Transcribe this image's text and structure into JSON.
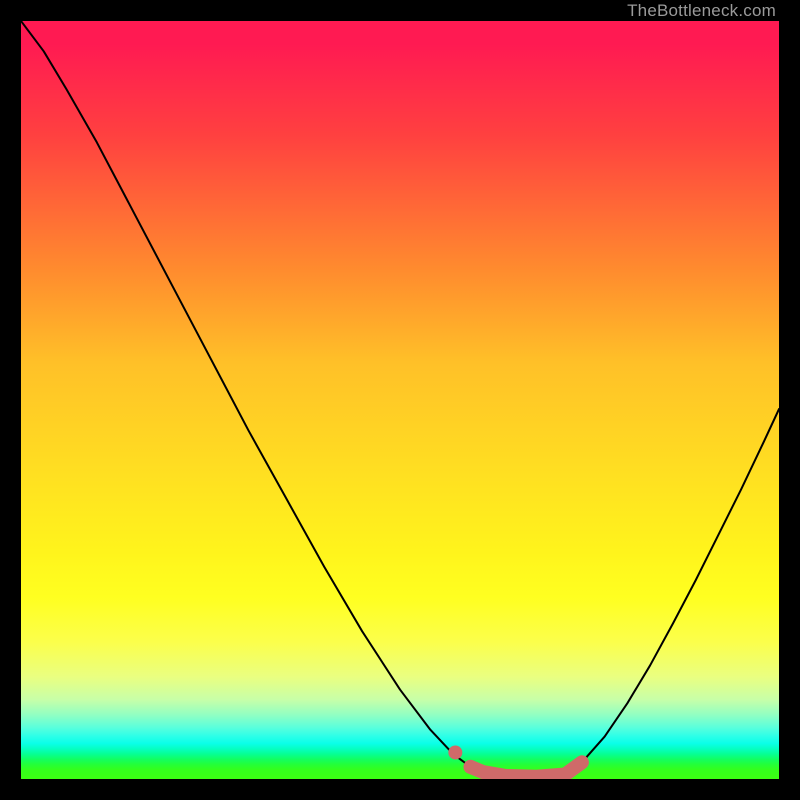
{
  "watermark": "TheBottleneck.com",
  "chart_data": {
    "type": "line",
    "title": "",
    "xlabel": "",
    "ylabel": "",
    "xlim": [
      0,
      1
    ],
    "ylim": [
      0,
      1
    ],
    "grid": false,
    "legend": false,
    "series": [
      {
        "name": "left-curve",
        "stroke": "#000000",
        "width": 2,
        "values": [
          {
            "x": 0.0,
            "y": 1.0
          },
          {
            "x": 0.03,
            "y": 0.96
          },
          {
            "x": 0.06,
            "y": 0.91
          },
          {
            "x": 0.1,
            "y": 0.84
          },
          {
            "x": 0.15,
            "y": 0.745
          },
          {
            "x": 0.2,
            "y": 0.65
          },
          {
            "x": 0.25,
            "y": 0.555
          },
          {
            "x": 0.3,
            "y": 0.46
          },
          {
            "x": 0.35,
            "y": 0.37
          },
          {
            "x": 0.4,
            "y": 0.28
          },
          {
            "x": 0.45,
            "y": 0.195
          },
          {
            "x": 0.5,
            "y": 0.118
          },
          {
            "x": 0.54,
            "y": 0.065
          },
          {
            "x": 0.57,
            "y": 0.033
          },
          {
            "x": 0.593,
            "y": 0.016
          },
          {
            "x": 0.61,
            "y": 0.009
          },
          {
            "x": 0.64,
            "y": 0.004
          },
          {
            "x": 0.68,
            "y": 0.003
          },
          {
            "x": 0.718,
            "y": 0.006
          }
        ]
      },
      {
        "name": "right-curve",
        "stroke": "#000000",
        "width": 2,
        "values": [
          {
            "x": 0.718,
            "y": 0.006
          },
          {
            "x": 0.74,
            "y": 0.022
          },
          {
            "x": 0.77,
            "y": 0.056
          },
          {
            "x": 0.8,
            "y": 0.1
          },
          {
            "x": 0.83,
            "y": 0.15
          },
          {
            "x": 0.86,
            "y": 0.205
          },
          {
            "x": 0.89,
            "y": 0.262
          },
          {
            "x": 0.92,
            "y": 0.322
          },
          {
            "x": 0.95,
            "y": 0.382
          },
          {
            "x": 0.98,
            "y": 0.445
          },
          {
            "x": 1.0,
            "y": 0.488
          }
        ]
      },
      {
        "name": "highlight-band",
        "stroke": "#cf6a69",
        "width": 14,
        "values": [
          {
            "x": 0.593,
            "y": 0.016
          },
          {
            "x": 0.61,
            "y": 0.009
          },
          {
            "x": 0.64,
            "y": 0.004
          },
          {
            "x": 0.68,
            "y": 0.003
          },
          {
            "x": 0.718,
            "y": 0.006
          },
          {
            "x": 0.74,
            "y": 0.022
          }
        ]
      },
      {
        "name": "highlight-dots",
        "stroke": "#cf6a69",
        "values": [
          {
            "x": 0.573,
            "y": 0.035
          },
          {
            "x": 0.593,
            "y": 0.016
          }
        ]
      }
    ]
  }
}
